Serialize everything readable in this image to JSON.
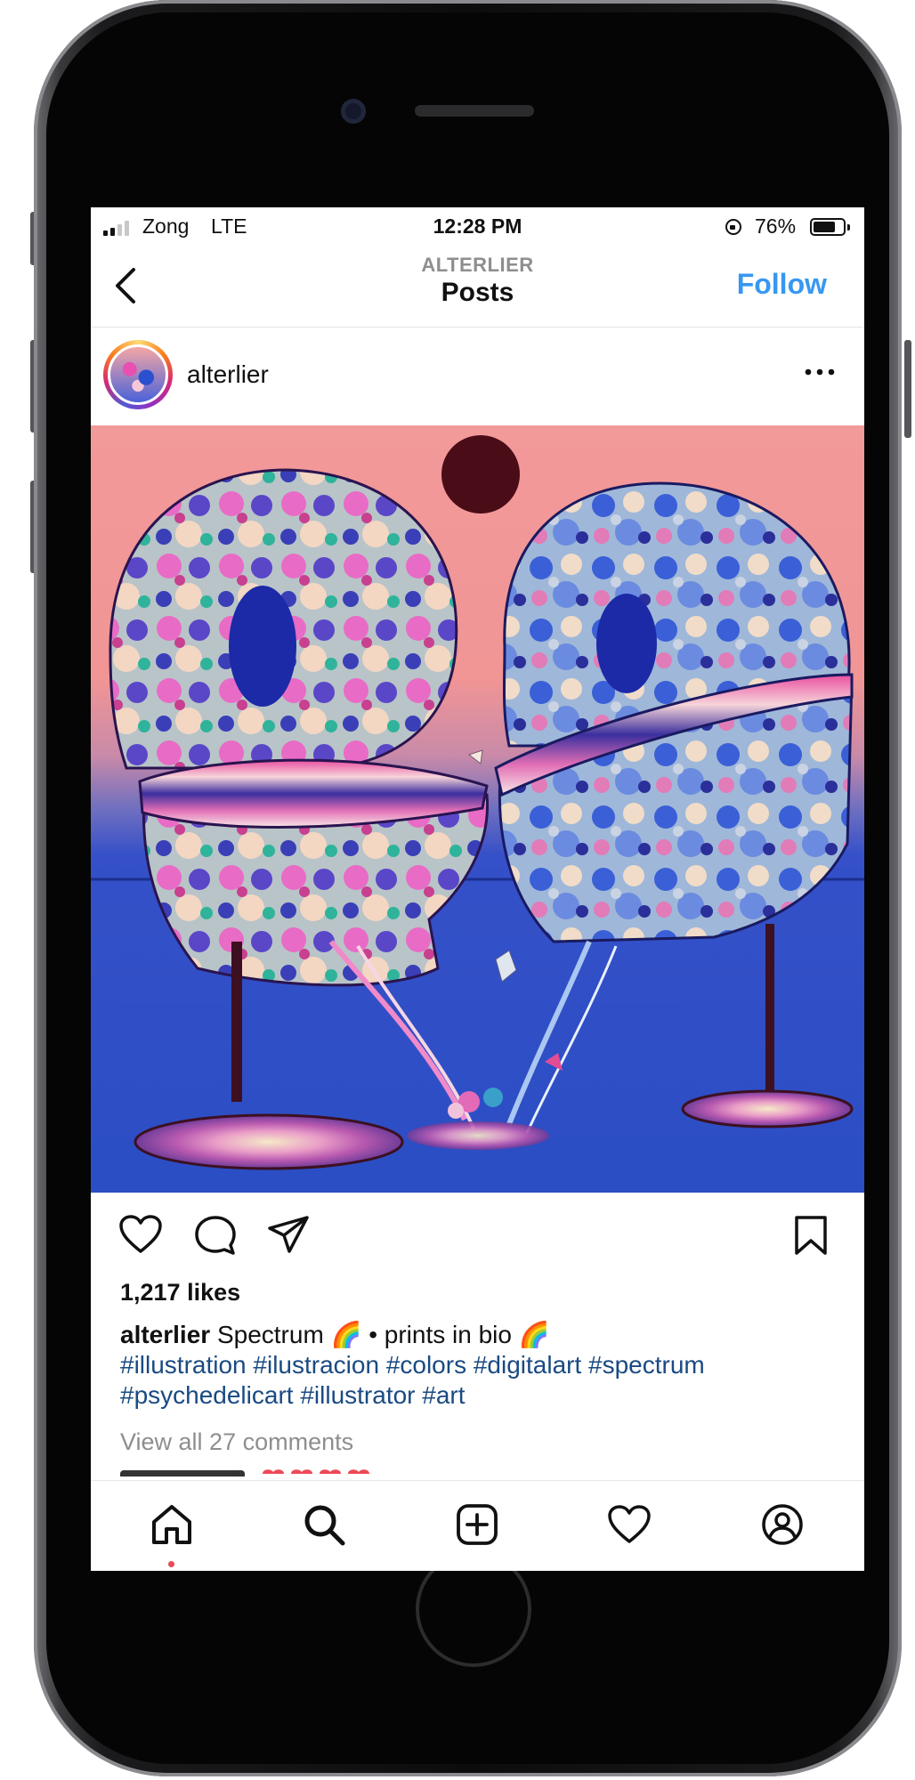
{
  "status_bar": {
    "carrier": "Zong",
    "network": "LTE",
    "time": "12:28 PM",
    "battery_percent": "76%",
    "battery_level": 0.76,
    "signal_bars_total": 4,
    "signal_bars_active": 2
  },
  "nav": {
    "subtitle": "ALTERLIER",
    "title": "Posts",
    "follow_label": "Follow",
    "back_icon": "chevron-left-icon"
  },
  "post": {
    "username": "alterlier",
    "more_icon": "ellipsis-icon",
    "image_description_icon": "artwork-image",
    "likes": "1,217 likes",
    "caption_user": "alterlier",
    "caption_text": " Spectrum 🌈 • prints in bio 🌈",
    "hashtags": "#illustration #ilustracion #colors #digitalart #spectrum #psychedelicart #illustrator #art",
    "comments_link": "View all 27 comments"
  },
  "actions": [
    "heart-icon",
    "comment-icon",
    "share-icon",
    "bookmark-icon"
  ],
  "tab_bar": [
    "home-icon",
    "search-icon",
    "add-post-icon",
    "activity-heart-icon",
    "profile-icon"
  ],
  "colors": {
    "accent_blue": "#3897f0",
    "hashtag_blue": "#1a4a82",
    "notification_red": "#ed4956",
    "art_sky": "#f2999a",
    "art_sea": "#2c4fc4"
  }
}
